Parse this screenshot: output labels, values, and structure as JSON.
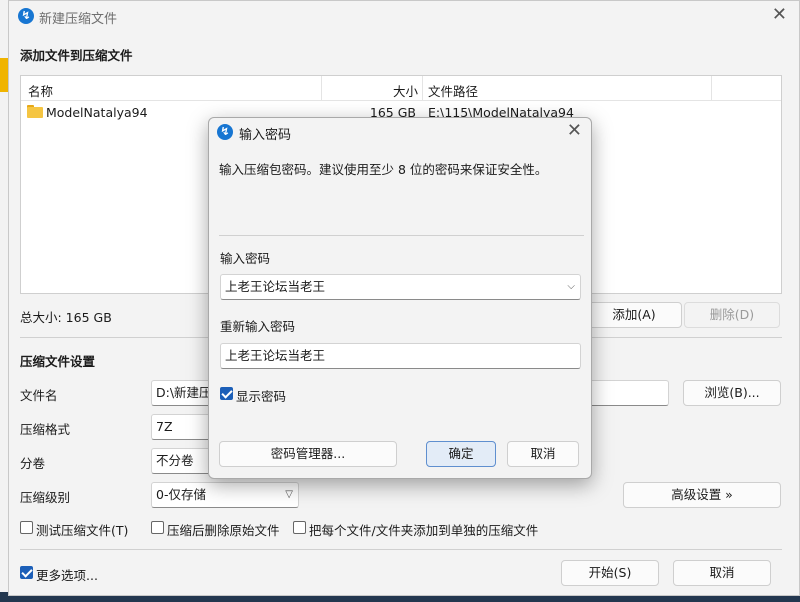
{
  "main_window": {
    "title": "新建压缩文件",
    "add_section_title": "添加文件到压缩文件",
    "list_headers": {
      "name": "名称",
      "size": "大小",
      "path": "文件路径"
    },
    "files": [
      {
        "name": "ModelNatalya94",
        "size": "165 GB",
        "path": "E:\\115\\ModelNatalya94"
      }
    ],
    "total_size": "总大小: 165 GB",
    "add_button": "添加(A)",
    "delete_button": "删除(D)",
    "settings_title": "压缩文件设置",
    "filename_label": "文件名",
    "filename_value": "D:\\新建压",
    "browse_button": "浏览(B)...",
    "format_label": "压缩格式",
    "format_value": "7Z",
    "split_label": "分卷",
    "split_value": "不分卷",
    "level_label": "压缩级别",
    "level_value": "0-仅存储",
    "advanced_button": "高级设置 »",
    "options": [
      {
        "label": "测试压缩文件(T)",
        "checked": false
      },
      {
        "label": "压缩后删除原始文件",
        "checked": false
      },
      {
        "label": "把每个文件/文件夹添加到单独的压缩文件",
        "checked": false
      }
    ],
    "more_options": {
      "label": "更多选项...",
      "checked": true
    },
    "start_button": "开始(S)",
    "cancel_button": "取消"
  },
  "password_dialog": {
    "title": "输入密码",
    "description": "输入压缩包密码。建议使用至少 8 位的密码来保证安全性。",
    "password_label": "输入密码",
    "password_value": "上老王论坛当老王",
    "reenter_label": "重新输入密码",
    "reenter_value": "上老王论坛当老王",
    "show_password": {
      "label": "显示密码",
      "checked": true
    },
    "manager_button": "密码管理器...",
    "ok_button": "确定",
    "cancel_button": "取消"
  },
  "colors": {
    "accent": "#1c5fb8",
    "window_bg": "#f3f3f3",
    "desktop": "#1f4c7a"
  },
  "icons": {
    "app": "archive-app-icon",
    "folder": "folder-icon",
    "close": "close-icon",
    "dropdown": "chevron-down-icon"
  }
}
